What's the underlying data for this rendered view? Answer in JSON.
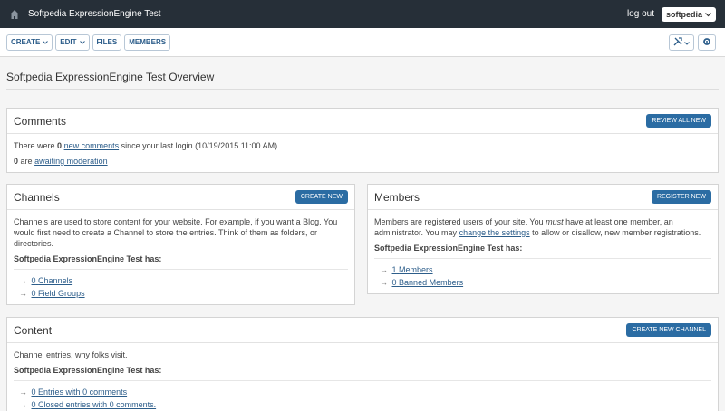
{
  "topbar": {
    "site_name": "Softpedia ExpressionEngine Test",
    "logout": "log out",
    "user": "softpedia"
  },
  "nav": {
    "create": "CREATE",
    "edit": "EDIT",
    "files": "FILES",
    "members": "MEMBERS"
  },
  "page_title": "Softpedia ExpressionEngine Test Overview",
  "comments": {
    "title": "Comments",
    "button": "REVIEW ALL NEW",
    "line1_pre": "There were",
    "line1_count": "0",
    "line1_link": "new comments",
    "line1_post": "since your last login (10/19/2015 11:00 AM)",
    "line2_count": "0",
    "line2_pre": "are",
    "line2_link": "awaiting moderation"
  },
  "channels": {
    "title": "Channels",
    "button": "CREATE NEW",
    "desc": "Channels are used to store content for your website. For example, if you want a Blog. You would first need to create a Channel to store the entries. Think of them as folders, or directories.",
    "has": "Softpedia ExpressionEngine Test has:",
    "items": [
      {
        "count": "0",
        "label": "Channels"
      },
      {
        "count": "0",
        "label": "Field Groups"
      }
    ]
  },
  "members": {
    "title": "Members",
    "button": "REGISTER NEW",
    "desc_pre": "Members are registered users of your site. You",
    "desc_em": "must",
    "desc_mid": "have at least one member, an administrator. You may",
    "desc_link": "change the settings",
    "desc_post": "to allow or disallow, new member registrations.",
    "has": "Softpedia ExpressionEngine Test has:",
    "items": [
      {
        "count": "1",
        "label": "Members"
      },
      {
        "count": "0",
        "label": "Banned Members"
      }
    ]
  },
  "content": {
    "title": "Content",
    "button": "CREATE NEW CHANNEL",
    "desc": "Channel entries, why folks visit.",
    "has": "Softpedia ExpressionEngine Test has:",
    "items": [
      {
        "count": "0",
        "label": "Entries with 0 comments"
      },
      {
        "count": "0",
        "label": "Closed entries with 0 comments."
      }
    ]
  }
}
